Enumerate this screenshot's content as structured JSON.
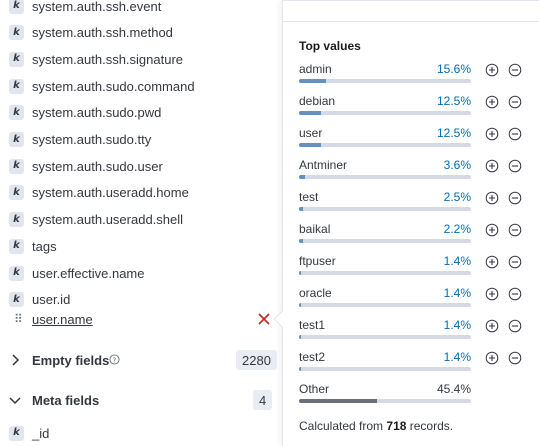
{
  "fields": [
    {
      "type": "k",
      "name": "system.auth.ssh.event"
    },
    {
      "type": "k",
      "name": "system.auth.ssh.method"
    },
    {
      "type": "k",
      "name": "system.auth.ssh.signature"
    },
    {
      "type": "k",
      "name": "system.auth.sudo.command"
    },
    {
      "type": "k",
      "name": "system.auth.sudo.pwd"
    },
    {
      "type": "k",
      "name": "system.auth.sudo.tty"
    },
    {
      "type": "k",
      "name": "system.auth.sudo.user"
    },
    {
      "type": "k",
      "name": "system.auth.useradd.home"
    },
    {
      "type": "k",
      "name": "system.auth.useradd.shell"
    },
    {
      "type": "k",
      "name": "tags"
    },
    {
      "type": "k",
      "name": "user.effective.name"
    },
    {
      "type": "k",
      "name": "user.id"
    }
  ],
  "selected_field": {
    "name": "user.name",
    "drag_glyph": "⠿"
  },
  "empty_fields": {
    "label": "Empty fields",
    "count": "2280"
  },
  "meta_fields": {
    "label": "Meta fields",
    "count": "4"
  },
  "meta_items": [
    {
      "type": "k",
      "name": "_id"
    }
  ],
  "popover": {
    "title": "Top values",
    "values": [
      {
        "label": "admin",
        "percent": "15.6%",
        "fraction": 0.156
      },
      {
        "label": "debian",
        "percent": "12.5%",
        "fraction": 0.125
      },
      {
        "label": "user",
        "percent": "12.5%",
        "fraction": 0.125
      },
      {
        "label": "Antminer",
        "percent": "3.6%",
        "fraction": 0.036
      },
      {
        "label": "test",
        "percent": "2.5%",
        "fraction": 0.025
      },
      {
        "label": "baikal",
        "percent": "2.2%",
        "fraction": 0.022
      },
      {
        "label": "ftpuser",
        "percent": "1.4%",
        "fraction": 0.014
      },
      {
        "label": "oracle",
        "percent": "1.4%",
        "fraction": 0.014
      },
      {
        "label": "test1",
        "percent": "1.4%",
        "fraction": 0.014
      },
      {
        "label": "test2",
        "percent": "1.4%",
        "fraction": 0.014
      }
    ],
    "other": {
      "label": "Other",
      "percent": "45.4%",
      "fraction": 0.454
    },
    "footer": {
      "prefix": "Calculated from",
      "count": "718",
      "suffix": "records."
    }
  },
  "colors": {
    "accent": "#006bb8",
    "bar": "#6092c0",
    "other_bar": "#69707d",
    "close": "#bd271e"
  },
  "icons": {
    "filter_in": "plus-circle-icon",
    "filter_out": "minus-circle-icon",
    "close": "cross-icon",
    "help": "question-circle-icon",
    "chevron_right": "chevron-right-icon",
    "chevron_down": "chevron-down-icon"
  }
}
